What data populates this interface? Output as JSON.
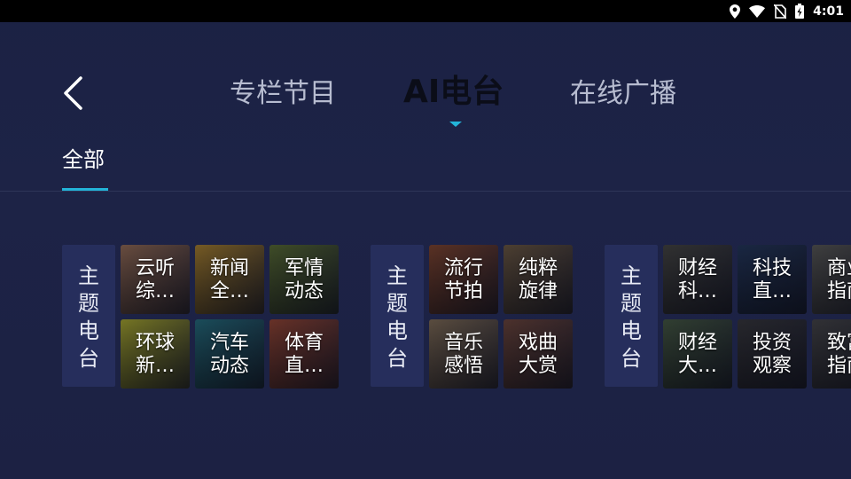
{
  "status_bar": {
    "time": "4:01",
    "icons": [
      "location-icon",
      "wifi-icon",
      "no-sim-icon",
      "battery-charging-icon"
    ]
  },
  "nav": {
    "back_icon": "chevron-left-icon",
    "tabs": [
      {
        "label": "专栏节目",
        "active": false
      },
      {
        "label": "AI电台",
        "active": true
      },
      {
        "label": "在线广播",
        "active": false
      }
    ],
    "accent_color": "#23b4d8"
  },
  "subtabs": [
    {
      "label": "全部",
      "active": true
    }
  ],
  "groups": [
    {
      "label": "主题电台",
      "cards": [
        {
          "title": "云听\n综…",
          "color": "#7b5a4a"
        },
        {
          "title": "新闻\n全…",
          "color": "#8a6a2a"
        },
        {
          "title": "军情\n动态",
          "color": "#4a5a2e"
        },
        {
          "title": "环球\n新…",
          "color": "#8a8a2a"
        },
        {
          "title": "汽车\n动态",
          "color": "#1f5a6a"
        },
        {
          "title": "体育\n直…",
          "color": "#7a3a2e"
        }
      ]
    },
    {
      "label": "主题电台",
      "cards": [
        {
          "title": "流行\n节拍",
          "color": "#6a3a2a"
        },
        {
          "title": "纯粹\n旋律",
          "color": "#5a4a3a"
        },
        {
          "title": "音乐\n感悟",
          "color": "#6a5a4a"
        },
        {
          "title": "戏曲\n大赏",
          "color": "#5a3a34"
        }
      ]
    },
    {
      "label": "主题电台",
      "cards": [
        {
          "title": "财经\n科…",
          "color": "#3a3a3a"
        },
        {
          "title": "科技\n直…",
          "color": "#1e2e4e"
        },
        {
          "title": "商业\n指南",
          "color": "#4a4a4a"
        },
        {
          "title": "财经\n大…",
          "color": "#3a4a3a"
        },
        {
          "title": "投资\n观察",
          "color": "#2e2e34"
        },
        {
          "title": "致富\n指南",
          "color": "#3a3a3e"
        }
      ]
    }
  ]
}
